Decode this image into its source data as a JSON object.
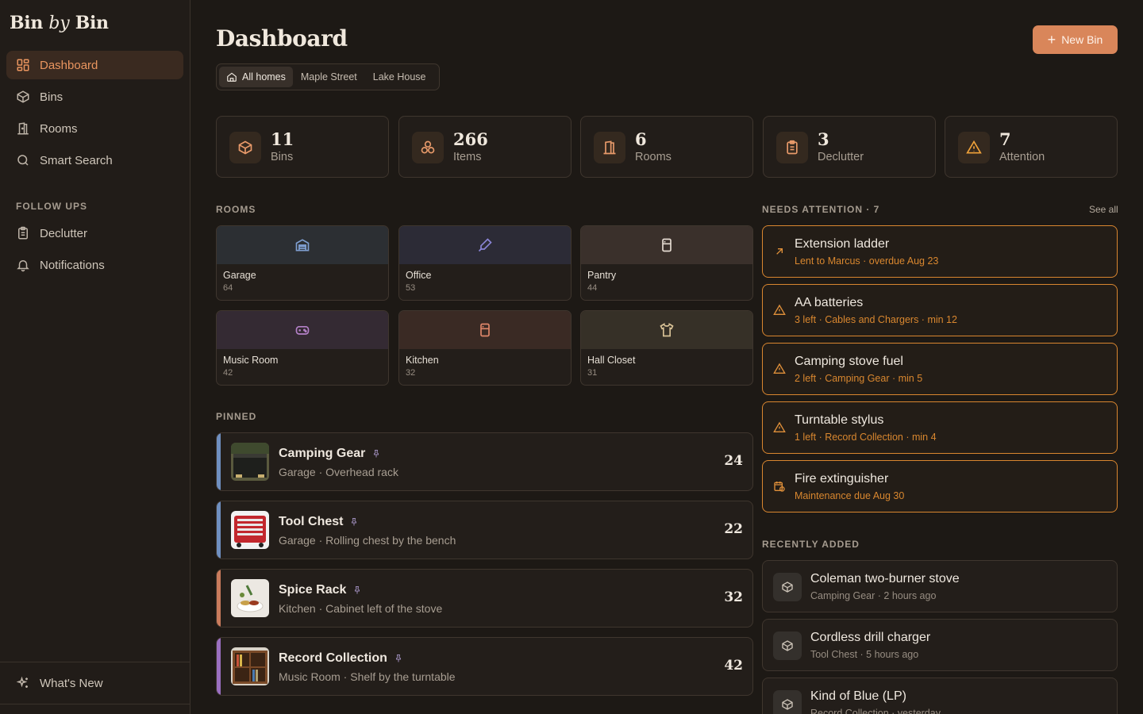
{
  "brand": {
    "bin": "Bin",
    "by": "by",
    "bin2": "Bin"
  },
  "sidebar": {
    "nav": [
      {
        "label": "Dashboard",
        "icon": "dashboard-icon"
      },
      {
        "label": "Bins",
        "icon": "box-icon"
      },
      {
        "label": "Rooms",
        "icon": "door-icon"
      },
      {
        "label": "Smart Search",
        "icon": "search-icon"
      }
    ],
    "follow_ups_label": "FOLLOW UPS",
    "follow_ups": [
      {
        "label": "Declutter",
        "icon": "clipboard-icon"
      },
      {
        "label": "Notifications",
        "icon": "bell-icon"
      }
    ],
    "footer_label": "What's New"
  },
  "header": {
    "title": "Dashboard",
    "new_bin_label": "New Bin",
    "home_tabs": [
      "All homes",
      "Maple Street",
      "Lake House"
    ]
  },
  "stats": [
    {
      "value": "11",
      "label": "Bins",
      "icon": "box-icon"
    },
    {
      "value": "266",
      "label": "Items",
      "icon": "items-icon"
    },
    {
      "value": "6",
      "label": "Rooms",
      "icon": "door-icon"
    },
    {
      "value": "3",
      "label": "Declutter",
      "icon": "clipboard-icon"
    },
    {
      "value": "7",
      "label": "Attention",
      "icon": "warning-icon"
    }
  ],
  "rooms": {
    "heading": "ROOMS",
    "items": [
      {
        "name": "Garage",
        "count": "64",
        "icon": "garage-icon",
        "bg": "#2c2f33",
        "color": "#7f9fd1"
      },
      {
        "name": "Office",
        "count": "53",
        "icon": "pen-icon",
        "bg": "#2c2b36",
        "color": "#8a84d6"
      },
      {
        "name": "Pantry",
        "count": "44",
        "icon": "fridge-icon",
        "bg": "#3a302b",
        "color": "#e6dcd2"
      },
      {
        "name": "Music Room",
        "count": "42",
        "icon": "gamepad-icon",
        "bg": "#342a33",
        "color": "#b481c8"
      },
      {
        "name": "Kitchen",
        "count": "32",
        "icon": "fridge-icon",
        "bg": "#3a2a24",
        "color": "#e0876a"
      },
      {
        "name": "Hall Closet",
        "count": "31",
        "icon": "shirt-icon",
        "bg": "#363027",
        "color": "#d8c196"
      }
    ]
  },
  "pinned": {
    "heading": "PINNED",
    "items": [
      {
        "name": "Camping Gear",
        "sub": "Garage · Overhead rack",
        "count": "24",
        "accent": "#6f8fc0"
      },
      {
        "name": "Tool Chest",
        "sub": "Garage · Rolling chest by the bench",
        "count": "22",
        "accent": "#6f8fc0"
      },
      {
        "name": "Spice Rack",
        "sub": "Kitchen · Cabinet left of the stove",
        "count": "32",
        "accent": "#c97b5c"
      },
      {
        "name": "Record Collection",
        "sub": "Music Room · Shelf by the turntable",
        "count": "42",
        "accent": "#9a6fc0"
      }
    ]
  },
  "attention": {
    "heading": "NEEDS ATTENTION · 7",
    "see_all": "See all",
    "items": [
      {
        "title": "Extension ladder",
        "sub": "Lent to Marcus · overdue Aug 23",
        "icon": "arrow-up-right-icon"
      },
      {
        "title": "AA batteries",
        "sub": "3 left · Cables and Chargers · min 12",
        "icon": "warning-icon"
      },
      {
        "title": "Camping stove fuel",
        "sub": "2 left · Camping Gear · min 5",
        "icon": "warning-icon"
      },
      {
        "title": "Turntable stylus",
        "sub": "1 left · Record Collection · min 4",
        "icon": "warning-icon"
      },
      {
        "title": "Fire extinguisher",
        "sub": "Maintenance due Aug 30",
        "icon": "calendar-clock-icon"
      }
    ]
  },
  "recent": {
    "heading": "RECENTLY ADDED",
    "items": [
      {
        "title": "Coleman two-burner stove",
        "sub": "Camping Gear · 2 hours ago"
      },
      {
        "title": "Cordless drill charger",
        "sub": "Tool Chest · 5 hours ago"
      },
      {
        "title": "Kind of Blue (LP)",
        "sub": "Record Collection · yesterday"
      }
    ]
  }
}
